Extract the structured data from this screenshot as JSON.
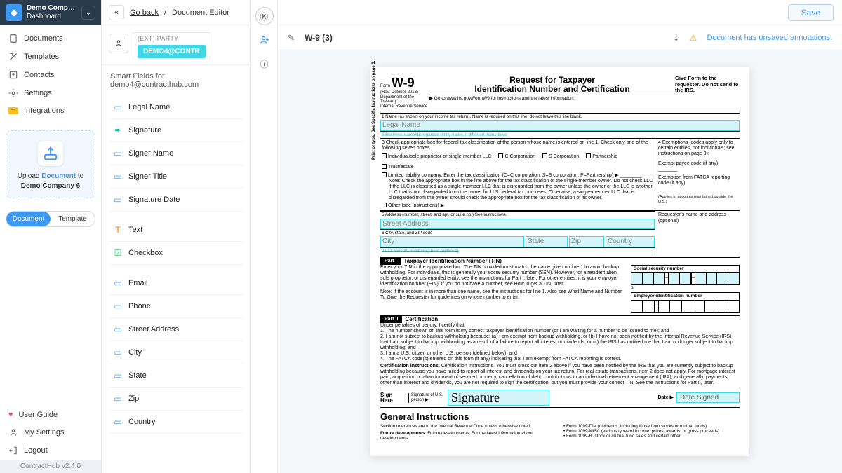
{
  "sidebar": {
    "company_name": "Demo Compa...",
    "company_sub": "Dashboard",
    "nav": [
      {
        "label": "Documents"
      },
      {
        "label": "Templates"
      },
      {
        "label": "Contacts"
      },
      {
        "label": "Settings"
      },
      {
        "label": "Integrations"
      }
    ],
    "upload_line1_pre": "Upload ",
    "upload_line1_link": "Document",
    "upload_line1_post": " to",
    "upload_line2": "Demo Company 6",
    "pill_doc": "Document",
    "pill_tmpl": "Template",
    "footer": [
      {
        "label": "User Guide"
      },
      {
        "label": "My Settings"
      },
      {
        "label": "Logout"
      }
    ],
    "version": "ContractHub v2.4.0"
  },
  "fields": {
    "collapse": "«",
    "bc_back": "Go back",
    "bc_sep": "/",
    "bc_current": "Document Editor",
    "party_label": "(EXT) PARTY",
    "party_chip": "DEMO4@CONTR",
    "title": "Smart Fields for demo4@contracthub.com",
    "items": [
      {
        "label": "Legal Name",
        "icon": "id",
        "color": "blue"
      },
      {
        "label": "Signature",
        "icon": "sig",
        "color": "teal"
      },
      {
        "label": "Signer Name",
        "icon": "id",
        "color": "blue"
      },
      {
        "label": "Signer Title",
        "icon": "id",
        "color": "blue"
      },
      {
        "label": "Signature Date",
        "icon": "id",
        "color": "blue"
      },
      {
        "label": "Text",
        "icon": "T",
        "color": "orange",
        "sep": true
      },
      {
        "label": "Checkbox",
        "icon": "chk",
        "color": "green"
      },
      {
        "label": "Email",
        "icon": "id",
        "color": "blue",
        "sep": true
      },
      {
        "label": "Phone",
        "icon": "id",
        "color": "blue"
      },
      {
        "label": "Street Address",
        "icon": "id",
        "color": "blue"
      },
      {
        "label": "City",
        "icon": "id",
        "color": "blue"
      },
      {
        "label": "State",
        "icon": "id",
        "color": "blue"
      },
      {
        "label": "Zip",
        "icon": "id",
        "color": "blue"
      },
      {
        "label": "Country",
        "icon": "id",
        "color": "blue"
      }
    ]
  },
  "topbar": {
    "save": "Save"
  },
  "doctab": {
    "name": "W-9 (3)",
    "warning": "Document has unsaved annotations."
  },
  "w9": {
    "form_word": "Form",
    "w9": "W-9",
    "rev": "(Rev. October 2018)",
    "dept": "Department of the Treasury",
    "irs": "Internal Revenue Service",
    "title1": "Request for Taxpayer",
    "title2": "Identification Number and Certification",
    "goto": "▶ Go to www.irs.gov/FormW9 for instructions and the latest information.",
    "give": "Give Form to the requester. Do not send to the IRS.",
    "line1": "1  Name (as shown on your income tax return). Name is required on this line; do not leave this line blank.",
    "legal_name": "Legal Name",
    "line2": "2  Business name/disregarded entity name, if different from above",
    "line3": "3  Check appropriate box for federal tax classification of the person whose name is entered on line 1. Check only one of the following seven boxes.",
    "line4": "4  Exemptions (codes apply only to certain entities, not individuals; see instructions on page 3):",
    "exempt_payee": "Exempt payee code (if any)",
    "fatca": "Exemption from FATCA reporting code (if any)",
    "fatca_note": "(Applies to accounts maintained outside the U.S.)",
    "boxes": [
      "Individual/sole proprietor or single-member LLC",
      "C Corporation",
      "S Corporation",
      "Partnership",
      "Trust/estate"
    ],
    "llc_line": "Limited liability company. Enter the tax classification (C=C corporation, S=S corporation, P=Partnership) ▶",
    "llc_note": "Note: Check the appropriate box in the line above for the tax classification of the single-member owner. Do not check LLC if the LLC is classified as a single-member LLC that is disregarded from the owner unless the owner of the LLC is another LLC that is not disregarded from the owner for U.S. federal tax purposes. Otherwise, a single-member LLC that is disregarded from the owner should check the appropriate box for the tax classification of its owner.",
    "other": "Other (see instructions) ▶",
    "line5": "5  Address (number, street, and apt. or suite no.) See instructions.",
    "requester": "Requester's name and address (optional)",
    "street": "Street Address",
    "line6": "6  City, state, and ZIP code",
    "city": "City",
    "state": "State",
    "zip": "Zip",
    "country": "Country",
    "line7": "7  List account number(s) here (optional)",
    "part1": "Part I",
    "part1_title": "Taxpayer Identification Number (TIN)",
    "tin_text": "Enter your TIN in the appropriate box. The TIN provided must match the name given on line 1 to avoid backup withholding. For individuals, this is generally your social security number (SSN). However, for a resident alien, sole proprietor, or disregarded entity, see the instructions for Part I, later. For other entities, it is your employer identification number (EIN). If you do not have a number, see How to get a TIN, later.",
    "tin_note": "Note: If the account is in more than one name, see the instructions for line 1. Also see What Name and Number To Give the Requester for guidelines on whose number to enter.",
    "ssn": "Social security number",
    "or": "or",
    "ein": "Employer identification number",
    "part2": "Part II",
    "part2_title": "Certification",
    "cert_intro": "Under penalties of perjury, I certify that:",
    "cert1": "1. The number shown on this form is my correct taxpayer identification number (or I am waiting for a number to be issued to me); and",
    "cert2": "2. I am not subject to backup withholding because: (a) I am exempt from backup withholding, or (b) I have not been notified by the Internal Revenue Service (IRS) that I am subject to backup withholding as a result of a failure to report all interest or dividends, or (c) the IRS has notified me that I am no longer subject to backup withholding; and",
    "cert3": "3. I am a U.S. citizen or other U.S. person (defined below); and",
    "cert4": "4. The FATCA code(s) entered on this form (if any) indicating that I am exempt from FATCA reporting is correct.",
    "cert_instr": "Certification instructions. You must cross out item 2 above if you have been notified by the IRS that you are currently subject to backup withholding because you have failed to report all interest and dividends on your tax return. For real estate transactions, item 2 does not apply. For mortgage interest paid, acquisition or abandonment of secured property, cancellation of debt, contributions to an individual retirement arrangement (IRA), and generally, payments other than interest and dividends, you are not required to sign the certification, but you must provide your correct TIN. See the instructions for Part II, later.",
    "sign_here": "Sign Here",
    "sig_of": "Signature of U.S. person ▶",
    "signature": "Signature",
    "date_lbl": "Date ▶",
    "date_signed": "Date Signed",
    "gen_title": "General Instructions",
    "gen_l1": "Section references are to the Internal Revenue Code unless otherwise noted.",
    "gen_l2": "Future developments. For the latest information about developments",
    "gen_r1": "• Form 1099-DIV (dividends, including those from stocks or mutual funds)",
    "gen_r2": "• Form 1099-MISC (various types of income, prizes, awards, or gross proceeds)",
    "gen_r3": "• Form 1099-B (stock or mutual fund sales and certain other",
    "side_text": "Print or type.      See Specific Instructions on page 3."
  }
}
